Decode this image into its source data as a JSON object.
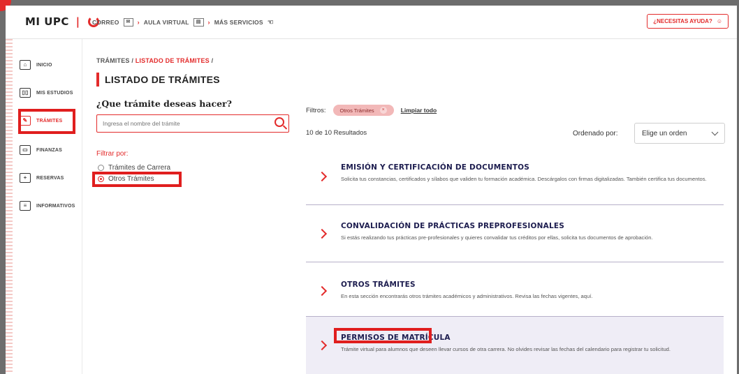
{
  "header": {
    "logo_text": "MI UPC",
    "nav": [
      {
        "label": "CORREO",
        "icon": "mail-icon"
      },
      {
        "label": "AULA VIRTUAL",
        "icon": "blackboard-icon"
      },
      {
        "label": "MÁS SERVICIOS",
        "icon": "hand-icon"
      }
    ],
    "help_label": "¿NECESITAS AYUDA?"
  },
  "sidebar": {
    "items": [
      {
        "label": "INICIO",
        "icon": "home-icon"
      },
      {
        "label": "MIS ESTUDIOS",
        "icon": "book-icon"
      },
      {
        "label": "TRÁMITES",
        "icon": "edit-document-icon",
        "active": true
      },
      {
        "label": "FINANZAS",
        "icon": "card-icon"
      },
      {
        "label": "RESERVAS",
        "icon": "calendar-icon"
      },
      {
        "label": "INFORMATIVOS",
        "icon": "news-icon"
      }
    ]
  },
  "breadcrumb": {
    "root": "TRÁMITES",
    "sep": "/",
    "current": "LISTADO DE TRÁMITES",
    "trail": "/"
  },
  "page_title": "LISTADO DE TRÁMITES",
  "search": {
    "question": "¿Que trámite deseas hacer?",
    "placeholder": "Ingresa el nombre del trámite"
  },
  "filters": {
    "label": "Filtrar por:",
    "options": [
      {
        "label": "Trámites de Carrera",
        "selected": false
      },
      {
        "label": "Otros Trámites",
        "selected": true
      }
    ]
  },
  "results": {
    "filters_label": "Filtros:",
    "active_tag": "Otros Trámites",
    "clear_label": "Limpiar todo",
    "count_text": "10 de 10 Resultados",
    "order_label": "Ordenado por:",
    "order_value": "Elige un orden",
    "cards": [
      {
        "title": "EMISIÓN Y CERTIFICACIÓN DE DOCUMENTOS",
        "description": "Solicita tus constancias, certificados y sílabos que validen tu formación académica. Descárgalos con firmas digitalizadas. También certifica tus documentos."
      },
      {
        "title": "CONVALIDACIÓN DE PRÁCTICAS PREPROFESIONALES",
        "description": "Si estás realizando tus prácticas pre-profesionales y quieres convalidar tus créditos por ellas, solicita tus documentos de aprobación."
      },
      {
        "title": "OTROS TRÁMITES",
        "description": "En esta sección encontrarás otros trámites académicos y administrativos. Revisa las fechas vigentes, aquí."
      },
      {
        "title": "PERMISOS DE MATRÍCULA",
        "description": "Trámite virtual para alumnos que deseen llevar cursos de otra carrera. No olvides revisar las fechas del calendario para registrar tu solicitud."
      }
    ]
  },
  "colors": {
    "accent": "#e32b2b",
    "highlight_box": "#e01e1e",
    "card_bg": "#efedf6",
    "title_text": "#1d1d4f"
  }
}
